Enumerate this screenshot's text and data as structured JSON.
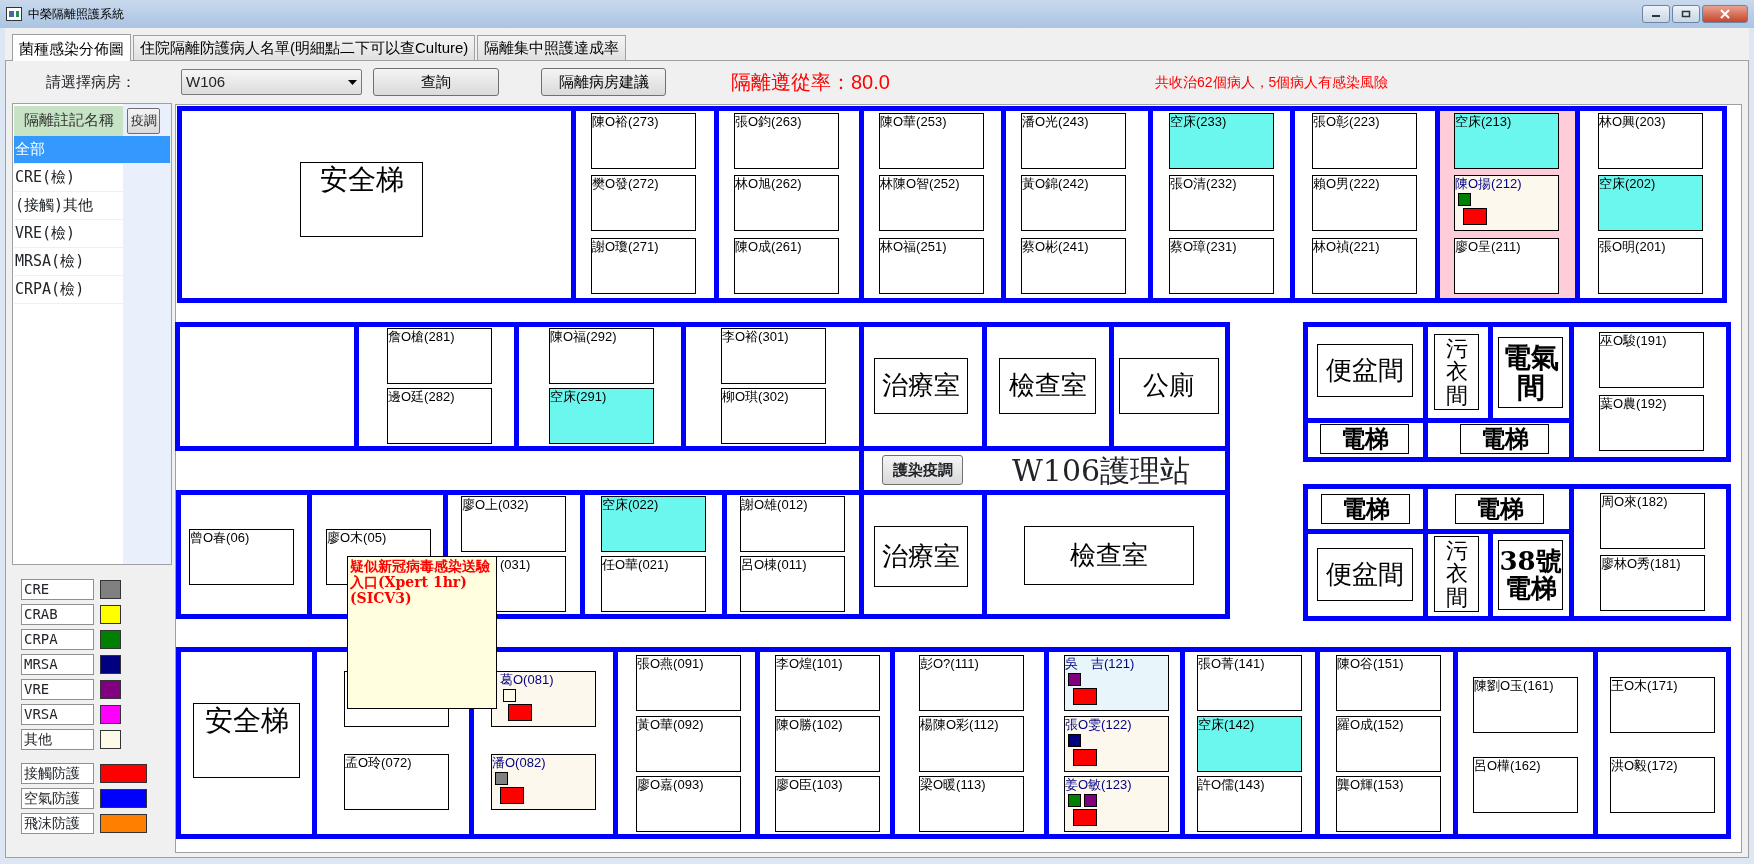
{
  "window": {
    "title": "中榮隔離照護系統"
  },
  "tabs": [
    {
      "label": "菌種感染分佈圖",
      "selected": true
    },
    {
      "label": "住院隔離防護病人名單(明細點二下可以查Culture)",
      "selected": false
    },
    {
      "label": "隔離集中照護達成率",
      "selected": false
    }
  ],
  "toolbar": {
    "ward_label": "請選擇病房：",
    "ward_select": {
      "value": "W106"
    },
    "buttons": [
      "查詢",
      "隔離病房建議"
    ],
    "compliance": "隔離遵從率：80.0",
    "summary": "共收治62個病人，5個病人有感染風險"
  },
  "sidebar": {
    "header": "隔離註記名稱",
    "button": "疫調",
    "items": [
      {
        "label": "全部",
        "selected": true
      },
      {
        "label": "CRE(檢)",
        "selected": false
      },
      {
        "label": "(接觸)其他",
        "selected": false
      },
      {
        "label": "VRE(檢)",
        "selected": false
      },
      {
        "label": "MRSA(檢)",
        "selected": false
      },
      {
        "label": "CRPA(檢)",
        "selected": false
      }
    ]
  },
  "legend": {
    "organisms": [
      {
        "label": "CRE",
        "color": "#808080"
      },
      {
        "label": "CRAB",
        "color": "#ffff00"
      },
      {
        "label": "CRPA",
        "color": "#008000"
      },
      {
        "label": "MRSA",
        "color": "#000080"
      },
      {
        "label": "VRE",
        "color": "#800080"
      },
      {
        "label": "VRSA",
        "color": "#ff00ff"
      },
      {
        "label": "其他",
        "color": "#fdfae8"
      }
    ],
    "precautions": [
      {
        "label": "接觸防護",
        "color": "#ff0000"
      },
      {
        "label": "空氣防護",
        "color": "#0000ff"
      },
      {
        "label": "飛沫防護",
        "color": "#ff8000"
      }
    ]
  },
  "floor_plan": {
    "rooms": [
      {
        "label": "安全梯"
      },
      {
        "label": "治療室"
      },
      {
        "label": "檢查室"
      },
      {
        "label": "公廁"
      },
      {
        "label": "治療室"
      },
      {
        "label": "檢查室"
      },
      {
        "label": "安全梯"
      },
      {
        "label": "便盆間"
      },
      {
        "label": "污衣間"
      },
      {
        "label": "電氣間"
      },
      {
        "label": "電梯"
      },
      {
        "label": "電梯"
      },
      {
        "label": "電梯"
      },
      {
        "label": "電梯"
      },
      {
        "label": "便盆間"
      },
      {
        "label": "污衣間"
      },
      {
        "label": "38號電梯"
      }
    ],
    "station_button": "護染疫調",
    "station_label": "W106護理站",
    "bays": [
      {
        "highlighted": false,
        "beds": [
          {
            "label": "陳O裕(273)",
            "empty": false,
            "at_risk": false,
            "highlighted": false
          },
          {
            "label": "樊O發(272)",
            "empty": false,
            "at_risk": false,
            "highlighted": false
          },
          {
            "label": "謝O瓊(271)",
            "empty": false,
            "at_risk": false,
            "highlighted": false
          }
        ]
      },
      {
        "highlighted": false,
        "beds": [
          {
            "label": "張O鈞(263)",
            "empty": false,
            "at_risk": false,
            "highlighted": false
          },
          {
            "label": "林O旭(262)",
            "empty": false,
            "at_risk": false,
            "highlighted": false
          },
          {
            "label": "陳O成(261)",
            "empty": false,
            "at_risk": false,
            "highlighted": false
          }
        ]
      },
      {
        "highlighted": false,
        "beds": [
          {
            "label": "陳O華(253)",
            "empty": false,
            "at_risk": false,
            "highlighted": false
          },
          {
            "label": "林陳O智(252)",
            "empty": false,
            "at_risk": false,
            "highlighted": false
          },
          {
            "label": "林O福(251)",
            "empty": false,
            "at_risk": false,
            "highlighted": false
          }
        ]
      },
      {
        "highlighted": false,
        "beds": [
          {
            "label": "潘O光(243)",
            "empty": false,
            "at_risk": false,
            "highlighted": false
          },
          {
            "label": "黃O錦(242)",
            "empty": false,
            "at_risk": false,
            "highlighted": false
          },
          {
            "label": "蔡O彬(241)",
            "empty": false,
            "at_risk": false,
            "highlighted": false
          }
        ]
      },
      {
        "highlighted": false,
        "beds": [
          {
            "label": "空床(233)",
            "empty": true,
            "at_risk": false,
            "highlighted": false
          },
          {
            "label": "張O清(232)",
            "empty": false,
            "at_risk": false,
            "highlighted": false
          },
          {
            "label": "蔡O璋(231)",
            "empty": false,
            "at_risk": false,
            "highlighted": false
          }
        ]
      },
      {
        "highlighted": false,
        "beds": [
          {
            "label": "張O彰(223)",
            "empty": false,
            "at_risk": false,
            "highlighted": false
          },
          {
            "label": "賴O男(222)",
            "empty": false,
            "at_risk": false,
            "highlighted": false
          },
          {
            "label": "林O禎(221)",
            "empty": false,
            "at_risk": false,
            "highlighted": false
          }
        ]
      },
      {
        "highlighted": true,
        "beds": [
          {
            "label": "空床(213)",
            "empty": true,
            "at_risk": false,
            "highlighted": false
          },
          {
            "label": "陳O揚(212)",
            "empty": false,
            "at_risk": true,
            "highlighted": false,
            "marks": [
              {
                "color": "#008000"
              }
            ],
            "precaution": {
              "color": "#ff0000"
            }
          },
          {
            "label": "廖O呈(211)",
            "empty": false,
            "at_risk": false,
            "highlighted": false
          }
        ]
      },
      {
        "highlighted": false,
        "beds": [
          {
            "label": "林O興(203)",
            "empty": false,
            "at_risk": false,
            "highlighted": false
          },
          {
            "label": "空床(202)",
            "empty": true,
            "at_risk": false,
            "highlighted": false
          },
          {
            "label": "張O明(201)",
            "empty": false,
            "at_risk": false,
            "highlighted": false
          }
        ]
      },
      {
        "highlighted": false,
        "beds": [
          {
            "label": "詹O槍(281)",
            "empty": false,
            "at_risk": false,
            "highlighted": false
          },
          {
            "label": "邊O廷(282)",
            "empty": false,
            "at_risk": false,
            "highlighted": false
          }
        ]
      },
      {
        "highlighted": false,
        "beds": [
          {
            "label": "陳O福(292)",
            "empty": false,
            "at_risk": false,
            "highlighted": false
          },
          {
            "label": "空床(291)",
            "empty": true,
            "at_risk": false,
            "highlighted": false
          }
        ]
      },
      {
        "highlighted": false,
        "beds": [
          {
            "label": "李O裕(301)",
            "empty": false,
            "at_risk": false,
            "highlighted": false
          },
          {
            "label": "柳O琪(302)",
            "empty": false,
            "at_risk": false,
            "highlighted": false
          }
        ]
      },
      {
        "highlighted": false,
        "beds": [
          {
            "label": "巫O駿(191)",
            "empty": false,
            "at_risk": false,
            "highlighted": false
          },
          {
            "label": "葉O農(192)",
            "empty": false,
            "at_risk": false,
            "highlighted": false
          }
        ]
      },
      {
        "highlighted": false,
        "beds": [
          {
            "label": "曾O春(06)",
            "empty": false,
            "at_risk": false,
            "highlighted": false
          }
        ]
      },
      {
        "highlighted": false,
        "beds": [
          {
            "label": "廖O木(05)",
            "empty": false,
            "at_risk": false,
            "highlighted": false
          }
        ]
      },
      {
        "highlighted": false,
        "beds": [
          {
            "label": "廖O上(032)",
            "empty": false,
            "at_risk": false,
            "highlighted": false
          },
          {
            "label": "(031)",
            "empty": false,
            "at_risk": false,
            "highlighted": false
          }
        ]
      },
      {
        "highlighted": false,
        "beds": [
          {
            "label": "空床(022)",
            "empty": true,
            "at_risk": false,
            "highlighted": false
          },
          {
            "label": "任O華(021)",
            "empty": false,
            "at_risk": false,
            "highlighted": false
          }
        ]
      },
      {
        "highlighted": false,
        "beds": [
          {
            "label": "謝O雄(012)",
            "empty": false,
            "at_risk": false,
            "highlighted": false
          },
          {
            "label": "呂O棟(011)",
            "empty": false,
            "at_risk": false,
            "highlighted": false
          }
        ]
      },
      {
        "highlighted": false,
        "beds": [
          {
            "label": "周O來(182)",
            "empty": false,
            "at_risk": false,
            "highlighted": false
          },
          {
            "label": "廖林O秀(181)",
            "empty": false,
            "at_risk": false,
            "highlighted": false
          }
        ]
      },
      {
        "highlighted": false,
        "beds": [
          {
            "empty": false,
            "at_risk": false,
            "highlighted": false
          },
          {
            "label": "孟O玲(072)",
            "empty": false,
            "at_risk": false,
            "highlighted": false
          }
        ]
      },
      {
        "highlighted": false,
        "beds": [
          {
            "label": "葛O(081)",
            "empty": false,
            "at_risk": true,
            "highlighted": false,
            "marks": [
              {
                "color": "#fdfae8"
              }
            ],
            "precaution": {
              "color": "#ff0000"
            }
          },
          {
            "label": "潘O(082)",
            "empty": false,
            "at_risk": true,
            "highlighted": false,
            "marks": [
              {
                "color": "#808080"
              }
            ],
            "precaution": {
              "color": "#ff0000"
            }
          }
        ]
      },
      {
        "highlighted": false,
        "beds": [
          {
            "label": "張O燕(091)",
            "empty": false,
            "at_risk": false,
            "highlighted": false
          },
          {
            "label": "黃O華(092)",
            "empty": false,
            "at_risk": false,
            "highlighted": false
          },
          {
            "label": "廖O嘉(093)",
            "empty": false,
            "at_risk": false,
            "highlighted": false
          }
        ]
      },
      {
        "highlighted": false,
        "beds": [
          {
            "label": "李O煌(101)",
            "empty": false,
            "at_risk": false,
            "highlighted": false
          },
          {
            "label": "陳O勝(102)",
            "empty": false,
            "at_risk": false,
            "highlighted": false
          },
          {
            "label": "廖O臣(103)",
            "empty": false,
            "at_risk": false,
            "highlighted": false
          }
        ]
      },
      {
        "highlighted": false,
        "beds": [
          {
            "label": "彭O?(111)",
            "empty": false,
            "at_risk": false,
            "highlighted": false
          },
          {
            "label": "楊陳O彩(112)",
            "empty": false,
            "at_risk": false,
            "highlighted": false
          },
          {
            "label": "梁O暖(113)",
            "empty": false,
            "at_risk": false,
            "highlighted": false
          }
        ]
      },
      {
        "highlighted": false,
        "beds": [
          {
            "label": "吳　吉(121)",
            "empty": false,
            "at_risk": true,
            "highlighted": true,
            "marks": [
              {
                "color": "#800080"
              }
            ],
            "precaution": {
              "color": "#ff0000"
            }
          },
          {
            "label": "張O雯(122)",
            "empty": false,
            "at_risk": true,
            "highlighted": false,
            "marks": [
              {
                "color": "#000080"
              }
            ],
            "precaution": {
              "color": "#ff0000"
            }
          },
          {
            "label": "姜O敏(123)",
            "empty": false,
            "at_risk": true,
            "highlighted": false,
            "marks": [
              {
                "color": "#008000"
              },
              {
                "color": "#800080"
              }
            ],
            "precaution": {
              "color": "#ff0000"
            }
          }
        ]
      },
      {
        "highlighted": false,
        "beds": [
          {
            "label": "張O菁(141)",
            "empty": false,
            "at_risk": false,
            "highlighted": false
          },
          {
            "label": "空床(142)",
            "empty": true,
            "at_risk": false,
            "highlighted": false
          },
          {
            "label": "許O儒(143)",
            "empty": false,
            "at_risk": false,
            "highlighted": false
          }
        ]
      },
      {
        "highlighted": false,
        "beds": [
          {
            "label": "陳O谷(151)",
            "empty": false,
            "at_risk": false,
            "highlighted": false
          },
          {
            "label": "羅O成(152)",
            "empty": false,
            "at_risk": false,
            "highlighted": false
          },
          {
            "label": "龔O輝(153)",
            "empty": false,
            "at_risk": false,
            "highlighted": false
          }
        ]
      },
      {
        "highlighted": false,
        "beds": [
          {
            "label": "陳劉O玉(161)",
            "empty": false,
            "at_risk": false,
            "highlighted": false
          },
          {
            "label": "呂O樺(162)",
            "empty": false,
            "at_risk": false,
            "highlighted": false
          }
        ]
      },
      {
        "highlighted": false,
        "beds": [
          {
            "label": "王O木(171)",
            "empty": false,
            "at_risk": false,
            "highlighted": false
          },
          {
            "label": "洪O毅(172)",
            "empty": false,
            "at_risk": false,
            "highlighted": false
          }
        ]
      }
    ],
    "tooltip": "疑似新冠病毒感染送驗入口(Xpert 1hr)(SICV3)"
  }
}
